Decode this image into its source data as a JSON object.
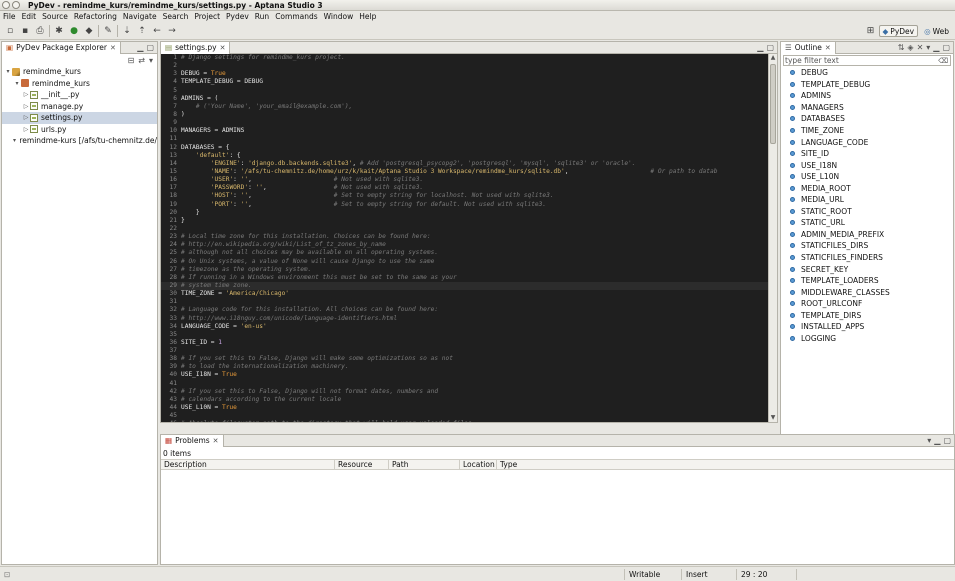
{
  "window": {
    "title": "PyDev - remindme_kurs/remindme_kurs/settings.py - Aptana Studio 3"
  },
  "menu": [
    "File",
    "Edit",
    "Source",
    "Refactoring",
    "Navigate",
    "Search",
    "Project",
    "Pydev",
    "Run",
    "Commands",
    "Window",
    "Help"
  ],
  "perspectives": {
    "pydev": "PyDev",
    "web": "Web"
  },
  "explorer": {
    "tab_label": "PyDev Package Explorer",
    "tree": [
      {
        "label": "remindme_kurs",
        "indent": 0,
        "icon": "project"
      },
      {
        "label": "remindme_kurs",
        "indent": 1,
        "icon": "package"
      },
      {
        "label": "__init__.py",
        "indent": 2,
        "icon": "file"
      },
      {
        "label": "manage.py",
        "indent": 2,
        "icon": "file"
      },
      {
        "label": "settings.py",
        "indent": 2,
        "icon": "file",
        "selected": true
      },
      {
        "label": "urls.py",
        "indent": 2,
        "icon": "file"
      },
      {
        "label": "remindme-kurs [/afs/tu-chemnitz.de/",
        "indent": 1,
        "icon": "project"
      }
    ]
  },
  "editor": {
    "tab_label": "settings.py",
    "current_line": 29,
    "lines": [
      [
        [
          "c",
          "# Django settings for remindme_kurs project."
        ]
      ],
      [],
      [
        [
          "t",
          "DEBUG = "
        ],
        [
          "k",
          "True"
        ]
      ],
      [
        [
          "t",
          "TEMPLATE_DEBUG = DEBUG"
        ]
      ],
      [],
      [
        [
          "t",
          "ADMINS = ("
        ]
      ],
      [
        [
          "c",
          "    # ('Your Name', 'your_email@example.com'),"
        ]
      ],
      [
        [
          "t",
          ")"
        ]
      ],
      [],
      [
        [
          "t",
          "MANAGERS = ADMINS"
        ]
      ],
      [],
      [
        [
          "t",
          "DATABASES = {"
        ]
      ],
      [
        [
          "t",
          "    "
        ],
        [
          "s",
          "'default'"
        ],
        [
          "t",
          ": {"
        ]
      ],
      [
        [
          "t",
          "        "
        ],
        [
          "s",
          "'ENGINE'"
        ],
        [
          "t",
          ": "
        ],
        [
          "s",
          "'django.db.backends.sqlite3'"
        ],
        [
          "t",
          ", "
        ],
        [
          "c",
          "# Add 'postgresql_psycopg2', 'postgresql', 'mysql', 'sqlite3' or 'oracle'."
        ]
      ],
      [
        [
          "t",
          "        "
        ],
        [
          "s",
          "'NAME'"
        ],
        [
          "t",
          ": "
        ],
        [
          "s",
          "'/afs/tu-chemnitz.de/home/urz/k/kait/Aptana Studio 3 Workspace/remindme_kurs/sqlite.db'"
        ],
        [
          "t",
          ",                      "
        ],
        [
          "c",
          "# Or path to datab"
        ]
      ],
      [
        [
          "t",
          "        "
        ],
        [
          "s",
          "'USER'"
        ],
        [
          "t",
          ": "
        ],
        [
          "s",
          "''"
        ],
        [
          "t",
          ",                      "
        ],
        [
          "c",
          "# Not used with sqlite3."
        ]
      ],
      [
        [
          "t",
          "        "
        ],
        [
          "s",
          "'PASSWORD'"
        ],
        [
          "t",
          ": "
        ],
        [
          "s",
          "''"
        ],
        [
          "t",
          ",                  "
        ],
        [
          "c",
          "# Not used with sqlite3."
        ]
      ],
      [
        [
          "t",
          "        "
        ],
        [
          "s",
          "'HOST'"
        ],
        [
          "t",
          ": "
        ],
        [
          "s",
          "''"
        ],
        [
          "t",
          ",                      "
        ],
        [
          "c",
          "# Set to empty string for localhost. Not used with sqlite3."
        ]
      ],
      [
        [
          "t",
          "        "
        ],
        [
          "s",
          "'PORT'"
        ],
        [
          "t",
          ": "
        ],
        [
          "s",
          "''"
        ],
        [
          "t",
          ",                      "
        ],
        [
          "c",
          "# Set to empty string for default. Not used with sqlite3."
        ]
      ],
      [
        [
          "t",
          "    }"
        ]
      ],
      [
        [
          "t",
          "}"
        ]
      ],
      [],
      [
        [
          "c",
          "# Local time zone for this installation. Choices can be found here:"
        ]
      ],
      [
        [
          "c",
          "# http://en.wikipedia.org/wiki/List_of_tz_zones_by_name"
        ]
      ],
      [
        [
          "c",
          "# although not all choices may be available on all operating systems."
        ]
      ],
      [
        [
          "c",
          "# On Unix systems, a value of None will cause Django to use the same"
        ]
      ],
      [
        [
          "c",
          "# timezone as the operating system."
        ]
      ],
      [
        [
          "c",
          "# If running in a Windows environment this must be set to the same as your"
        ]
      ],
      [
        [
          "c",
          "# system time zone."
        ]
      ],
      [
        [
          "t",
          "TIME_ZONE = "
        ],
        [
          "s",
          "'America/Chicago'"
        ]
      ],
      [],
      [
        [
          "c",
          "# Language code for this installation. All choices can be found here:"
        ]
      ],
      [
        [
          "c",
          "# http://www.i18nguy.com/unicode/language-identifiers.html"
        ]
      ],
      [
        [
          "t",
          "LANGUAGE_CODE = "
        ],
        [
          "s",
          "'en-us'"
        ]
      ],
      [],
      [
        [
          "t",
          "SITE_ID = "
        ],
        [
          "n",
          "1"
        ]
      ],
      [],
      [
        [
          "c",
          "# If you set this to False, Django will make some optimizations so as not"
        ]
      ],
      [
        [
          "c",
          "# to load the internationalization machinery."
        ]
      ],
      [
        [
          "t",
          "USE_I18N = "
        ],
        [
          "k",
          "True"
        ]
      ],
      [],
      [
        [
          "c",
          "# If you set this to False, Django will not format dates, numbers and"
        ]
      ],
      [
        [
          "c",
          "# calendars according to the current locale"
        ]
      ],
      [
        [
          "t",
          "USE_L10N = "
        ],
        [
          "k",
          "True"
        ]
      ],
      [],
      [
        [
          "c",
          "# Absolute filesystem path to the directory that will hold user-uploaded files."
        ]
      ]
    ]
  },
  "outline": {
    "tab_label": "Outline",
    "filter_placeholder": "type filter text",
    "items": [
      "DEBUG",
      "TEMPLATE_DEBUG",
      "ADMINS",
      "MANAGERS",
      "DATABASES",
      "TIME_ZONE",
      "LANGUAGE_CODE",
      "SITE_ID",
      "USE_I18N",
      "USE_L10N",
      "MEDIA_ROOT",
      "MEDIA_URL",
      "STATIC_ROOT",
      "STATIC_URL",
      "ADMIN_MEDIA_PREFIX",
      "STATICFILES_DIRS",
      "STATICFILES_FINDERS",
      "SECRET_KEY",
      "TEMPLATE_LOADERS",
      "MIDDLEWARE_CLASSES",
      "ROOT_URLCONF",
      "TEMPLATE_DIRS",
      "INSTALLED_APPS",
      "LOGGING"
    ]
  },
  "problems": {
    "tab_label": "Problems",
    "count": "0 items",
    "columns": [
      "Description",
      "Resource",
      "Path",
      "Location",
      "Type"
    ]
  },
  "status": {
    "writable": "Writable",
    "insert": "Insert",
    "position": "29 : 20"
  }
}
